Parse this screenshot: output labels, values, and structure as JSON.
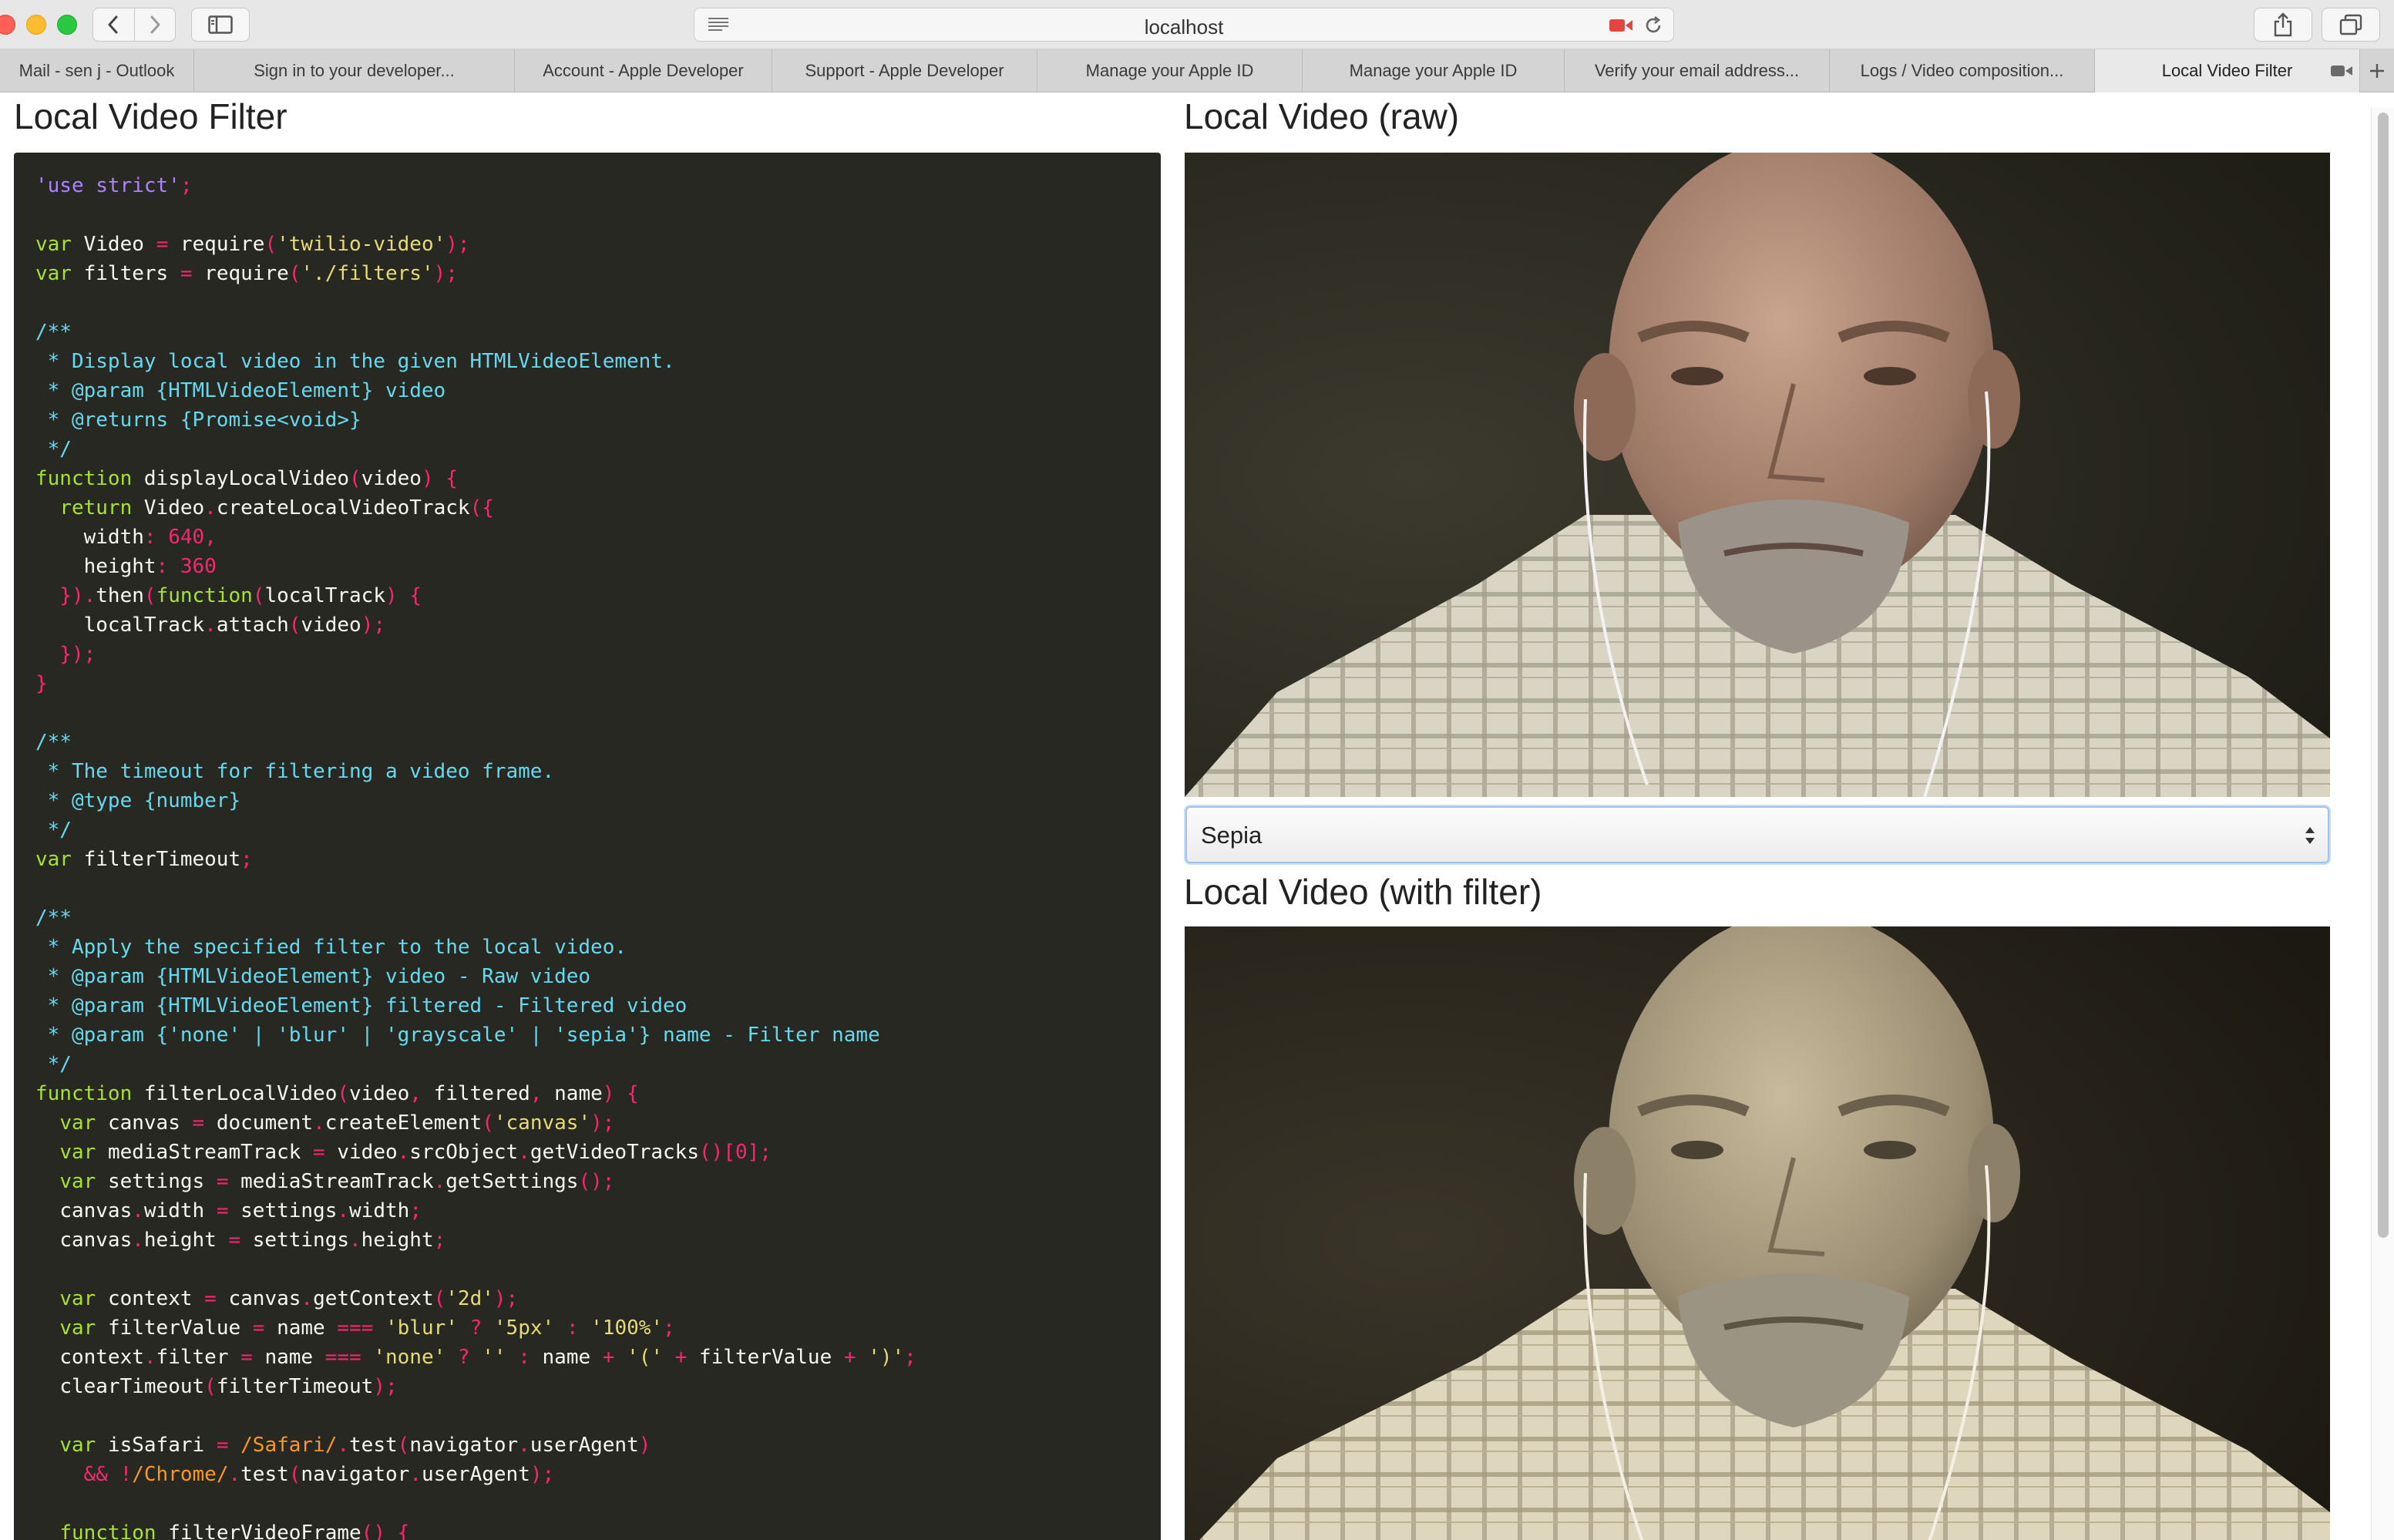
{
  "browser": {
    "url": "localhost",
    "tabs": [
      {
        "label": "Mail - sen j - Outlook",
        "active": false
      },
      {
        "label": "Sign in to your developer...",
        "active": false
      },
      {
        "label": "Account - Apple Developer",
        "active": false
      },
      {
        "label": "Support - Apple Developer",
        "active": false
      },
      {
        "label": "Manage your Apple ID",
        "active": false
      },
      {
        "label": "Manage your Apple ID",
        "active": false
      },
      {
        "label": "Verify your email address...",
        "active": false
      },
      {
        "label": "Logs / Video composition...",
        "active": false
      },
      {
        "label": "Local Video Filter",
        "active": true
      }
    ],
    "icons": [
      "back-icon",
      "forward-icon",
      "sidebar-icon",
      "reader-icon",
      "camera-recording-icon",
      "reload-icon",
      "share-icon",
      "tabs-overview-icon",
      "new-tab-icon"
    ]
  },
  "page": {
    "title": "Local Video Filter",
    "raw_heading": "Local Video (raw)",
    "filtered_heading": "Local Video (with filter)",
    "filter_select": {
      "selected": "Sepia"
    }
  },
  "code": {
    "language": "javascript",
    "lines": [
      "'use strict';",
      "",
      "var Video = require('twilio-video');",
      "var filters = require('./filters');",
      "",
      "/**",
      " * Display local video in the given HTMLVideoElement.",
      " * @param {HTMLVideoElement} video",
      " * @returns {Promise<void>}",
      " */",
      "function displayLocalVideo(video) {",
      "  return Video.createLocalVideoTrack({",
      "    width: 640,",
      "    height: 360",
      "  }).then(function(localTrack) {",
      "    localTrack.attach(video);",
      "  });",
      "}",
      "",
      "/**",
      " * The timeout for filtering a video frame.",
      " * @type {number}",
      " */",
      "var filterTimeout;",
      "",
      "/**",
      " * Apply the specified filter to the local video.",
      " * @param {HTMLVideoElement} video - Raw video",
      " * @param {HTMLVideoElement} filtered - Filtered video",
      " * @param {'none' | 'blur' | 'grayscale' | 'sepia'} name - Filter name",
      " */",
      "function filterLocalVideo(video, filtered, name) {",
      "  var canvas = document.createElement('canvas');",
      "  var mediaStreamTrack = video.srcObject.getVideoTracks()[0];",
      "  var settings = mediaStreamTrack.getSettings();",
      "  canvas.width = settings.width;",
      "  canvas.height = settings.height;",
      "",
      "  var context = canvas.getContext('2d');",
      "  var filterValue = name === 'blur' ? '5px' : '100%';",
      "  context.filter = name === 'none' ? '' : name + '(' + filterValue + ')';",
      "  clearTimeout(filterTimeout);",
      "",
      "  var isSafari = /Safari/.test(navigator.userAgent)",
      "    && !/Chrome/.test(navigator.userAgent);",
      "",
      "  function filterVideoFrame() {"
    ]
  },
  "colors": {
    "code_background": "#272822",
    "keyword": "#a6e22e",
    "string": "#e6db74",
    "comment": "#66d9ef",
    "number": "#f92672"
  }
}
